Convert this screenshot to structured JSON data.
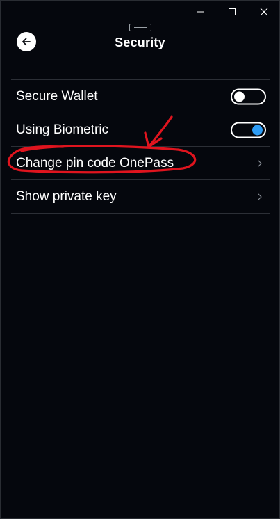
{
  "window": {
    "controls": {
      "minimize_icon": "minimize-icon",
      "maximize_icon": "maximize-icon",
      "close_icon": "close-icon"
    }
  },
  "header": {
    "title": "Security",
    "back_icon": "arrow-left-icon"
  },
  "settings": {
    "items": [
      {
        "label": "Secure Wallet",
        "type": "toggle",
        "enabled": false
      },
      {
        "label": "Using Biometric",
        "type": "toggle",
        "enabled": true
      },
      {
        "label": "Change pin code OnePass",
        "type": "link",
        "icon": "chevron-right-icon"
      },
      {
        "label": "Show private key",
        "type": "link",
        "icon": "chevron-right-icon"
      }
    ]
  },
  "annotation": {
    "color": "#e0141e",
    "target": "Change pin code OnePass"
  },
  "colors": {
    "background": "#05070d",
    "divider": "#2c2f36",
    "toggle_on_knob": "#2d9cf5",
    "text": "#ffffff"
  }
}
